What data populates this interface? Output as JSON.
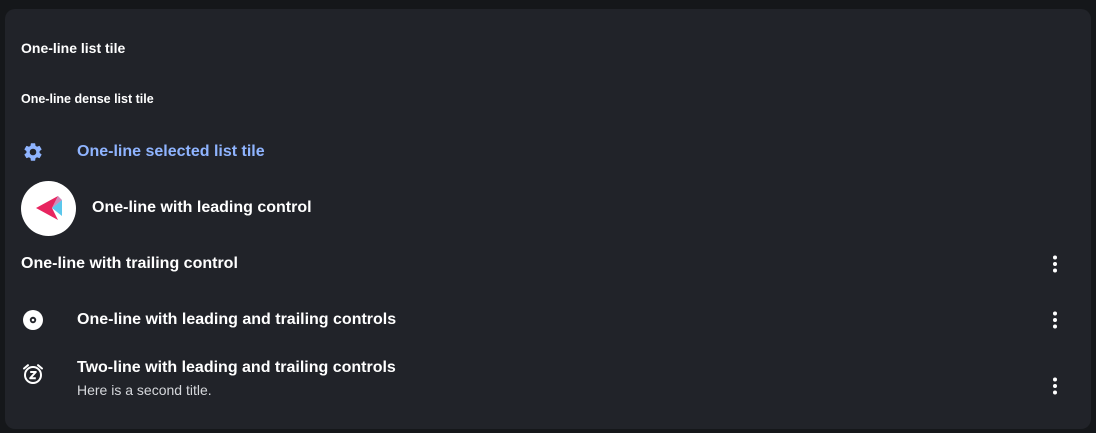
{
  "list": {
    "tiles": [
      {
        "title": "One-line list tile"
      },
      {
        "title": "One-line dense list tile"
      },
      {
        "title": "One-line selected list tile",
        "leading_icon": "gear-icon",
        "selected": true
      },
      {
        "title": "One-line with leading control",
        "leading_icon": "app-logo-avatar"
      },
      {
        "title": "One-line with trailing control",
        "trailing_icon": "more-vert-icon"
      },
      {
        "title": "One-line with leading and trailing controls",
        "leading_icon": "disc-icon",
        "trailing_icon": "more-vert-icon"
      },
      {
        "title": "Two-line with leading and trailing controls",
        "subtitle": "Here is a second title.",
        "leading_icon": "snooze-alarm-icon",
        "trailing_icon": "more-vert-icon"
      }
    ]
  },
  "colors": {
    "panel_background": "#212329",
    "page_background": "#15171a",
    "selected_accent": "#8fb4ff",
    "icon_color": "#ffffff"
  }
}
